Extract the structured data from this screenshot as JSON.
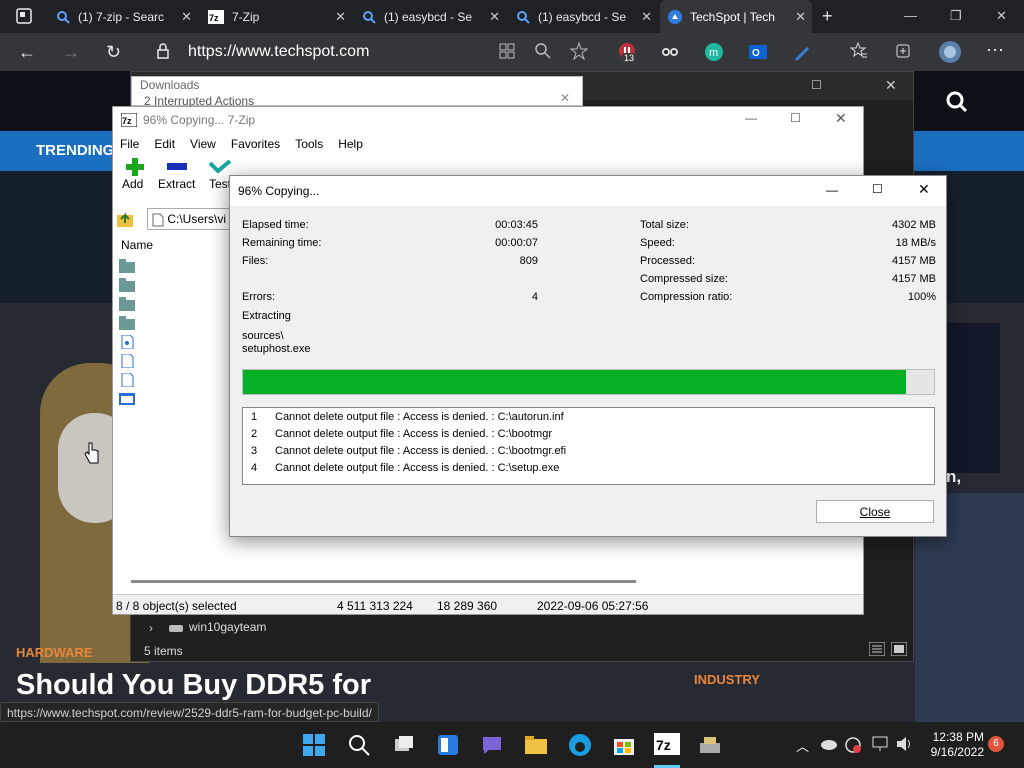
{
  "browser": {
    "tabs": [
      {
        "title": "(1) 7-zip - Searc"
      },
      {
        "title": "7-Zip"
      },
      {
        "title": "(1) easybcd - Se"
      },
      {
        "title": "(1) easybcd - Se"
      },
      {
        "title": "TechSpot | Tech"
      }
    ],
    "url": "https://www.techspot.com",
    "extension_badge": "13"
  },
  "website": {
    "trending_label": "TRENDING",
    "hero_category": "HARDWARE",
    "hero_title": "Should You Buy DDR5 for",
    "side_category": "INDUSTRY",
    "side_partial": "n,"
  },
  "downloads": {
    "title": "Downloads",
    "subtitle": "2 Interrupted Actions"
  },
  "explorer": {
    "item": "win10gayteam",
    "count": "5 items"
  },
  "zip_window": {
    "title": "96% Copying... 7-Zip",
    "menu": [
      "File",
      "Edit",
      "View",
      "Favorites",
      "Tools",
      "Help"
    ],
    "toolbar": [
      "Add",
      "Extract",
      "Test"
    ],
    "path": "C:\\Users\\vi",
    "column_name": "Name",
    "status": {
      "selected": "8 / 8 object(s) selected",
      "size": "4 511 313 224",
      "packed": "18 289 360",
      "modified": "2022-09-06 05:27:56"
    }
  },
  "dialog": {
    "title": "96% Copying...",
    "left_stats": [
      {
        "label": "Elapsed time:",
        "value": "00:03:45"
      },
      {
        "label": "Remaining time:",
        "value": "00:00:07"
      },
      {
        "label": "Files:",
        "value": "809"
      },
      {
        "label": "Errors:",
        "value": "4"
      }
    ],
    "right_stats": [
      {
        "label": "Total size:",
        "value": "4302 MB"
      },
      {
        "label": "Speed:",
        "value": "18 MB/s"
      },
      {
        "label": "Processed:",
        "value": "4157 MB"
      },
      {
        "label": "Compressed size:",
        "value": "4157 MB"
      },
      {
        "label": "Compression ratio:",
        "value": "100%"
      }
    ],
    "operation": "Extracting",
    "current_path": "sources\\",
    "current_file": "setuphost.exe",
    "progress": 0.96,
    "errors": [
      {
        "n": "1",
        "text": "Cannot delete output file : Access is denied. : C:\\autorun.inf"
      },
      {
        "n": "2",
        "text": "Cannot delete output file : Access is denied. : C:\\bootmgr"
      },
      {
        "n": "3",
        "text": "Cannot delete output file : Access is denied. : C:\\bootmgr.efi"
      },
      {
        "n": "4",
        "text": "Cannot delete output file : Access is denied. : C:\\setup.exe"
      }
    ],
    "close_label": "Close"
  },
  "status_link": "https://www.techspot.com/review/2529-ddr5-ram-for-budget-pc-build/",
  "taskbar": {
    "time": "12:38 PM",
    "date": "9/16/2022",
    "notifications": "6"
  },
  "colors": {
    "progress": "#06b025",
    "trending_bar": "#1a6fc1",
    "hero_accent": "#e8863b"
  }
}
